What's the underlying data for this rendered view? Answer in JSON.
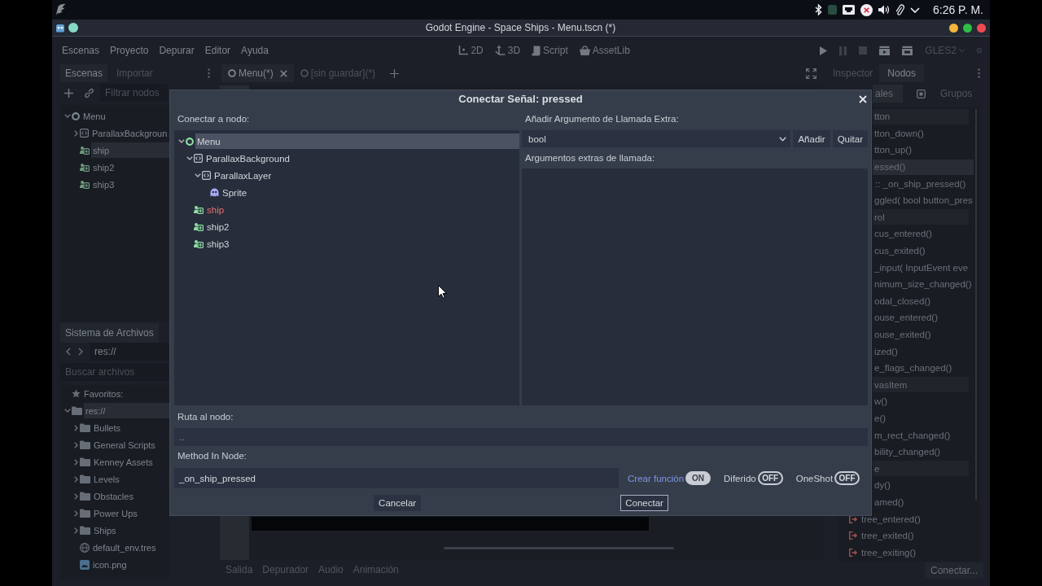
{
  "desktop_panel": {
    "clock": "6:26 P. M."
  },
  "window": {
    "title": "Godot Engine - Space Ships - Menu.tscn (*)"
  },
  "menu_bar": {
    "menus": [
      "Escenas",
      "Proyecto",
      "Depurar",
      "Editor",
      "Ayuda"
    ],
    "workspaces": [
      {
        "label": "2D",
        "kind": "canvas",
        "selected": false
      },
      {
        "label": "3D",
        "kind": "spatial",
        "selected": false
      },
      {
        "label": "Script",
        "kind": "script",
        "selected": false
      },
      {
        "label": "AssetLib",
        "kind": "assetlib",
        "selected": false
      }
    ],
    "renderer": "GLES2"
  },
  "scene_dock": {
    "tabs": [
      {
        "label": "Escenas",
        "selected": true
      },
      {
        "label": "Importar",
        "selected": false
      }
    ],
    "filter": {
      "placeholder": "Filtrar nodos"
    },
    "tree": [
      {
        "name": "Menu",
        "kind": "control",
        "expanded": true,
        "selected": false,
        "children": [
          {
            "name": "ParallaxBackgroun",
            "kind": "parallax",
            "expanded": false,
            "selected": false
          },
          {
            "name": "ship",
            "kind": "instance",
            "selected": true
          },
          {
            "name": "ship2",
            "kind": "instance",
            "selected": false
          },
          {
            "name": "ship3",
            "kind": "instance",
            "selected": false
          }
        ]
      }
    ]
  },
  "filesystem_dock": {
    "tab": "Sistema de Archivos",
    "path": "res://",
    "search": {
      "placeholder": "Buscar archivos"
    },
    "tree": [
      {
        "name": "Favoritos:",
        "kind": "favorites",
        "selected": false
      },
      {
        "name": "res://",
        "kind": "folder",
        "expanded": true,
        "selected": true,
        "children": [
          {
            "name": "Bullets",
            "kind": "folder",
            "expanded": false,
            "selected": false
          },
          {
            "name": "General Scripts",
            "kind": "folder",
            "expanded": false,
            "selected": false
          },
          {
            "name": "Kenney Assets",
            "kind": "folder",
            "expanded": false,
            "selected": false
          },
          {
            "name": "Levels",
            "kind": "folder",
            "expanded": false,
            "selected": false
          },
          {
            "name": "Obstacles",
            "kind": "folder",
            "expanded": false,
            "selected": false
          },
          {
            "name": "Power Ups",
            "kind": "folder",
            "expanded": false,
            "selected": false
          },
          {
            "name": "Ships",
            "kind": "folder",
            "expanded": false,
            "selected": false
          },
          {
            "name": "default_env.tres",
            "kind": "environment",
            "selected": false
          },
          {
            "name": "icon.png",
            "kind": "image",
            "selected": false
          }
        ]
      }
    ]
  },
  "scene_tabs": [
    {
      "label": "Menu(*)",
      "selected": true
    },
    {
      "label": "[sin guardar](*)",
      "selected": false
    }
  ],
  "bottom_tabs": [
    {
      "label": "Salida",
      "selected": false
    },
    {
      "label": "Depurador",
      "selected": false
    },
    {
      "label": "Audio",
      "selected": false
    },
    {
      "label": "Animación",
      "selected": false
    }
  ],
  "node_dock": {
    "tabs": [
      {
        "label": "Inspector",
        "selected": false
      },
      {
        "label": "Nodos",
        "selected": true
      }
    ],
    "sections": [
      {
        "label": "ales",
        "kind": "signals",
        "selected": true
      },
      {
        "label": "Grupos",
        "kind": "groups",
        "selected": false
      }
    ],
    "signals": {
      "beside_dialog": [
        {
          "text": "tton",
          "kind": "class"
        },
        {
          "text": "tton_down()",
          "kind": "signal",
          "selected": false
        },
        {
          "text": "tton_up()",
          "kind": "signal",
          "selected": false
        },
        {
          "text": "essed()",
          "kind": "signal",
          "selected": true
        },
        {
          "text": ":: _on_ship_pressed()",
          "kind": "connection",
          "selected": false
        },
        {
          "text": "ggled( bool button_pres",
          "kind": "signal",
          "selected": false
        },
        {
          "text": "rol",
          "kind": "class"
        },
        {
          "text": "cus_entered()",
          "kind": "signal",
          "selected": false
        },
        {
          "text": "cus_exited()",
          "kind": "signal",
          "selected": false
        },
        {
          "text": "_input( InputEvent eve",
          "kind": "signal",
          "selected": false
        },
        {
          "text": "nimum_size_changed()",
          "kind": "signal",
          "selected": false
        },
        {
          "text": "odal_closed()",
          "kind": "signal",
          "selected": false
        },
        {
          "text": "ouse_entered()",
          "kind": "signal",
          "selected": false
        },
        {
          "text": "ouse_exited()",
          "kind": "signal",
          "selected": false
        },
        {
          "text": "ized()",
          "kind": "signal",
          "selected": false
        },
        {
          "text": "e_flags_changed()",
          "kind": "signal",
          "selected": false
        },
        {
          "text": "vasItem",
          "kind": "class"
        },
        {
          "text": "w()",
          "kind": "signal",
          "selected": false
        },
        {
          "text": "e()",
          "kind": "signal",
          "selected": false
        },
        {
          "text": "m_rect_changed()",
          "kind": "signal",
          "selected": false
        },
        {
          "text": "bility_changed()",
          "kind": "signal",
          "selected": false
        },
        {
          "text": "e",
          "kind": "class"
        },
        {
          "text": "dy()",
          "kind": "signal",
          "selected": false
        },
        {
          "text": "amed()",
          "kind": "signal",
          "selected": false
        }
      ],
      "rows": [
        {
          "text": "tree_entered()",
          "kind": "signal",
          "selected": false
        },
        {
          "text": "tree_exited()",
          "kind": "signal",
          "selected": false
        },
        {
          "text": "tree_exiting()",
          "kind": "signal",
          "selected": false
        }
      ]
    },
    "connect_button": "Conectar..."
  },
  "dialog": {
    "title": "Conectar Señal: pressed",
    "node_label": "Conectar a nodo:",
    "tree": [
      {
        "name": "Menu",
        "kind": "control",
        "expanded": true,
        "selected": true,
        "emitter": false,
        "children": [
          {
            "name": "ParallaxBackground",
            "kind": "parallax",
            "expanded": true,
            "selected": false,
            "emitter": false,
            "children": [
              {
                "name": "ParallaxLayer",
                "kind": "parallax",
                "expanded": true,
                "selected": false,
                "emitter": false,
                "children": [
                  {
                    "name": "Sprite",
                    "kind": "sprite",
                    "selected": false,
                    "emitter": false
                  }
                ]
              }
            ]
          },
          {
            "name": "ship",
            "kind": "instance",
            "selected": false,
            "emitter": true
          },
          {
            "name": "ship2",
            "kind": "instance",
            "selected": false,
            "emitter": false
          },
          {
            "name": "ship3",
            "kind": "instance",
            "selected": false,
            "emitter": false
          }
        ]
      }
    ],
    "extra_args": {
      "label": "Añadir Argumento de Llamada Extra:",
      "type": "bool",
      "add_button": "Añadir",
      "remove_button": "Quitar",
      "list_label": "Argumentos extras de llamada:"
    },
    "path": {
      "label": "Ruta al nodo:",
      "value": ".."
    },
    "method": {
      "label": "Method In Node:",
      "value": "_on_ship_pressed"
    },
    "options": [
      {
        "label": "Crear función",
        "on": true,
        "switch_text": "ON"
      },
      {
        "label": "Diferido",
        "on": false,
        "switch_text": "OFF"
      },
      {
        "label": "OneShot",
        "on": false,
        "switch_text": "OFF"
      }
    ],
    "buttons": [
      {
        "label": "Cancelar",
        "focused": false
      },
      {
        "label": "Conectar",
        "focused": true
      }
    ]
  }
}
